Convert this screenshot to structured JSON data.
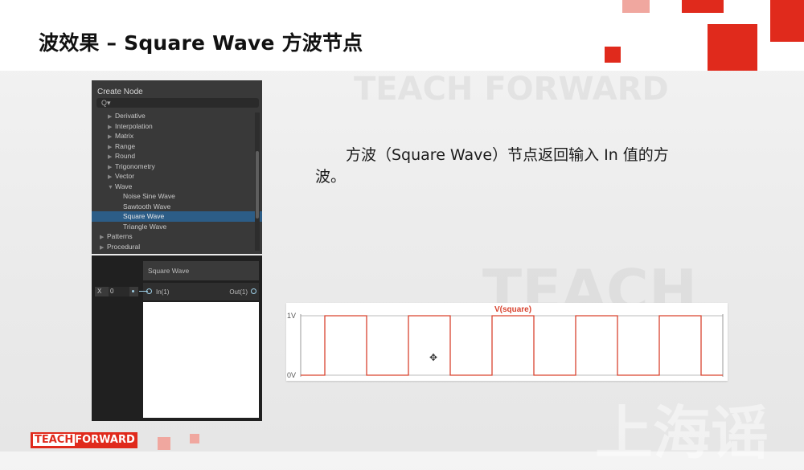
{
  "slide": {
    "title": "波效果 – Square Wave 方波节点",
    "description": "方波（Square Wave）节点返回输入 In 值的方波。",
    "watermark_top": "TEACH FORWARD",
    "watermark_bottom": "TEACH",
    "watermark_cn": "上海谣"
  },
  "create_node": {
    "title": "Create Node",
    "search_placeholder": "Q▾",
    "items": [
      {
        "label": "Derivative",
        "indent": 1,
        "arrow": "▶",
        "selected": false
      },
      {
        "label": "Interpolation",
        "indent": 1,
        "arrow": "▶",
        "selected": false
      },
      {
        "label": "Matrix",
        "indent": 1,
        "arrow": "▶",
        "selected": false
      },
      {
        "label": "Range",
        "indent": 1,
        "arrow": "▶",
        "selected": false
      },
      {
        "label": "Round",
        "indent": 1,
        "arrow": "▶",
        "selected": false
      },
      {
        "label": "Trigonometry",
        "indent": 1,
        "arrow": "▶",
        "selected": false
      },
      {
        "label": "Vector",
        "indent": 1,
        "arrow": "▶",
        "selected": false
      },
      {
        "label": "Wave",
        "indent": 1,
        "arrow": "▼",
        "selected": false
      },
      {
        "label": "Noise Sine Wave",
        "indent": 2,
        "arrow": "",
        "selected": false
      },
      {
        "label": "Sawtooth Wave",
        "indent": 2,
        "arrow": "",
        "selected": false
      },
      {
        "label": "Square Wave",
        "indent": 2,
        "arrow": "",
        "selected": true
      },
      {
        "label": "Triangle Wave",
        "indent": 2,
        "arrow": "",
        "selected": false
      },
      {
        "label": "Patterns",
        "indent": 0,
        "arrow": "▶",
        "selected": false
      },
      {
        "label": "Procedural",
        "indent": 0,
        "arrow": "▶",
        "selected": false
      }
    ]
  },
  "node": {
    "title": "Square Wave",
    "input_label": "In(1)",
    "output_label": "Out(1)",
    "x_label": "X",
    "x_value": "0"
  },
  "waveform": {
    "title": "V(square)",
    "y_top_label": "1V",
    "y_bottom_label": "0V",
    "line_color": "#d9432f",
    "title_color": "#d9432f"
  },
  "footer": {
    "logo_teach": "TEACH",
    "logo_forward": "FORWARD"
  },
  "colors": {
    "accent": "#e02a1c",
    "selection": "#2c5d87",
    "panel": "#393939"
  }
}
